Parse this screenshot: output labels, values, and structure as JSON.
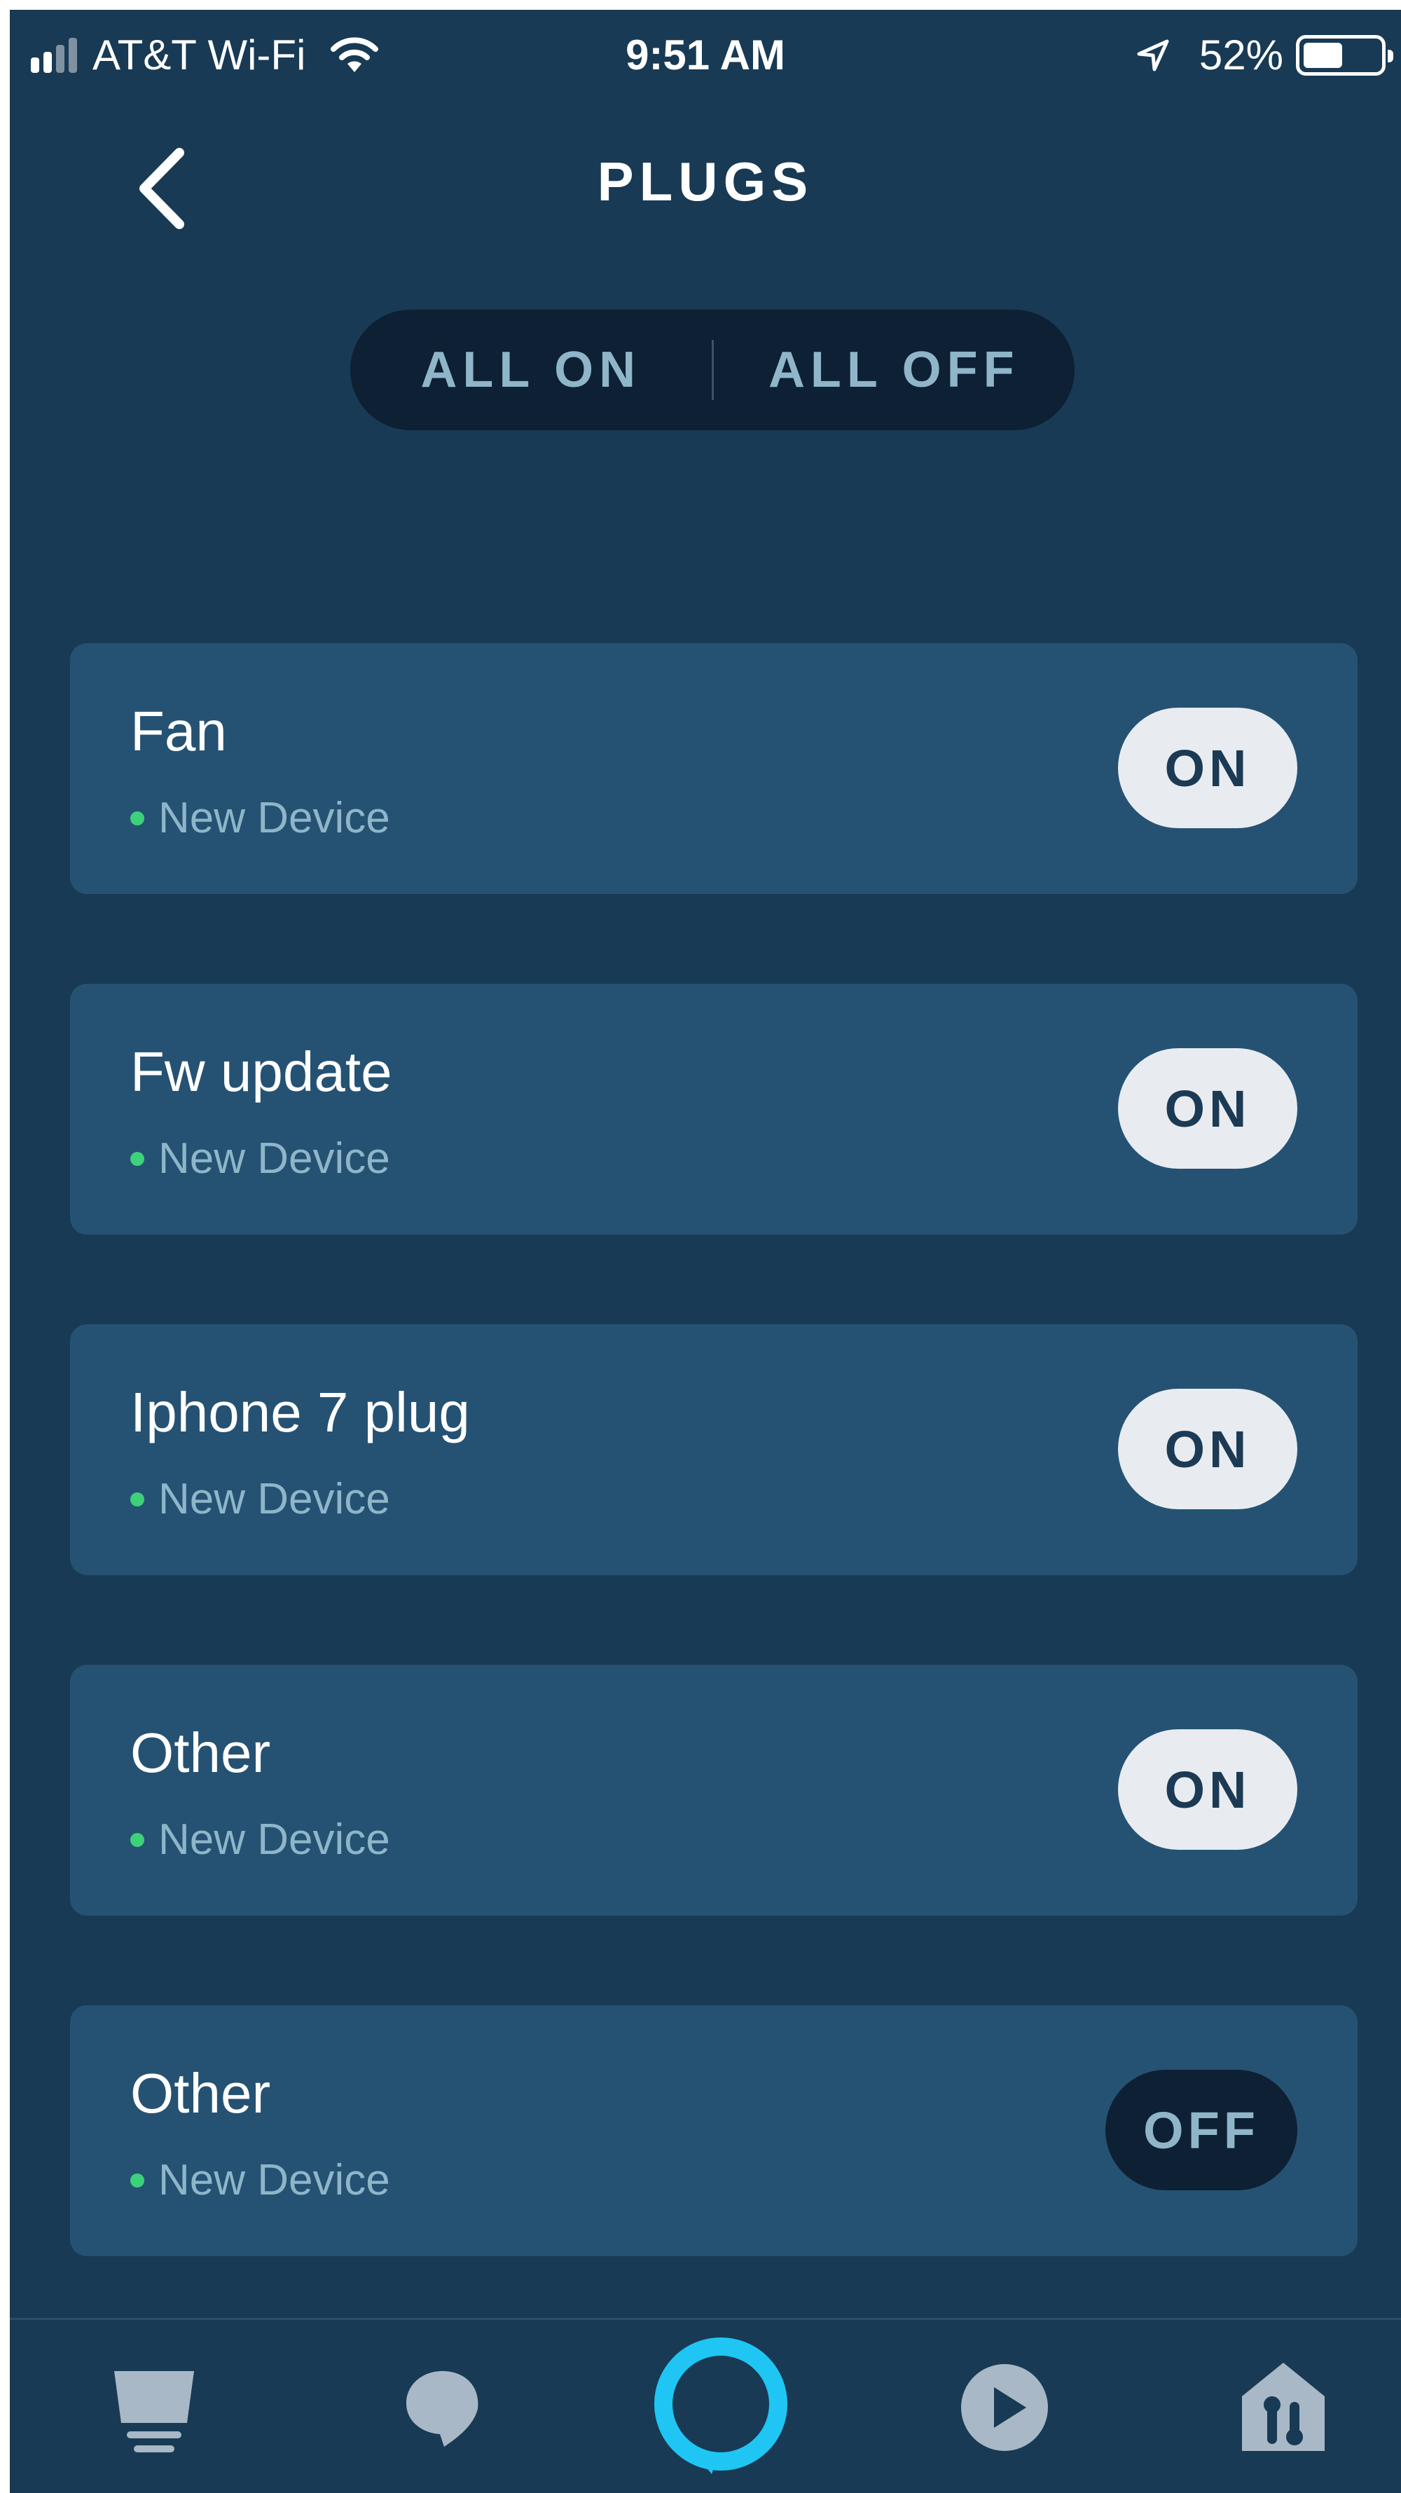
{
  "status_bar": {
    "carrier": "AT&T Wi-Fi",
    "time": "9:51 AM",
    "battery": "52%",
    "battery_level": 0.52
  },
  "header": {
    "title": "PLUGS",
    "back_icon": "chevron-left-icon"
  },
  "segmented": {
    "all_on": "ALL ON",
    "all_off": "ALL OFF"
  },
  "devices": [
    {
      "name": "Fan",
      "status": "New Device",
      "toggle": "ON",
      "state": "on"
    },
    {
      "name": "Fw update",
      "status": "New Device",
      "toggle": "ON",
      "state": "on"
    },
    {
      "name": "Iphone 7 plug",
      "status": "New Device",
      "toggle": "ON",
      "state": "on"
    },
    {
      "name": "Other",
      "status": "New Device",
      "toggle": "ON",
      "state": "on"
    },
    {
      "name": "Other",
      "status": "New Device",
      "toggle": "OFF",
      "state": "off"
    }
  ],
  "bottom_nav": [
    {
      "icon": "home-icon"
    },
    {
      "icon": "chat-icon"
    },
    {
      "icon": "alexa-icon"
    },
    {
      "icon": "play-icon"
    },
    {
      "icon": "devices-icon"
    }
  ],
  "colors": {
    "background": "#183A54",
    "card": "#255273",
    "accent": "#1FC6F3",
    "status_dot": "#3DD17A"
  }
}
